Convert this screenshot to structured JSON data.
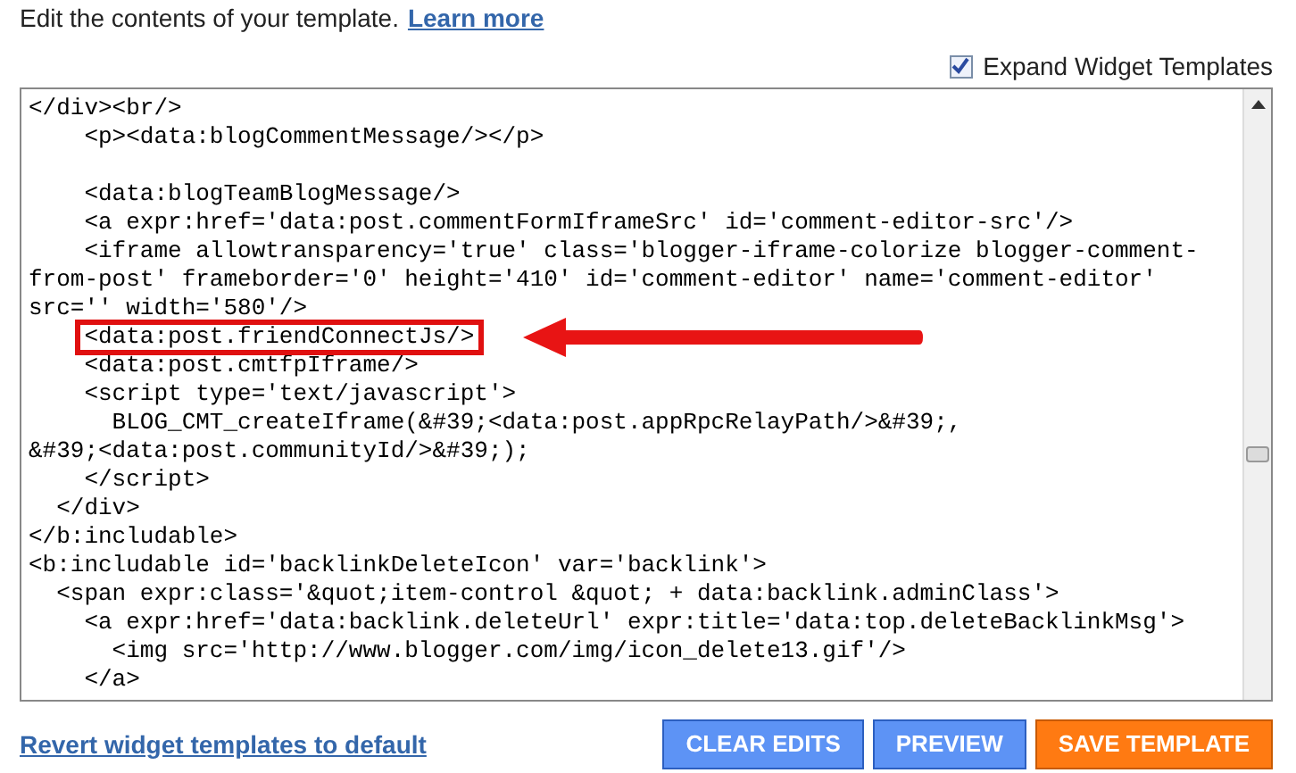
{
  "intro": {
    "text": "Edit the contents of your template.",
    "link": "Learn more"
  },
  "expand_widget_templates": {
    "label": "Expand Widget Templates",
    "checked": true
  },
  "editor": {
    "lines": [
      {
        "kind": "code",
        "text": "</div><br/>"
      },
      {
        "kind": "code",
        "text": "    <p><data:blogCommentMessage/></p>"
      },
      {
        "kind": "blank"
      },
      {
        "kind": "code",
        "text": "    <data:blogTeamBlogMessage/>"
      },
      {
        "kind": "code",
        "text": "    <a expr:href='data:post.commentFormIframeSrc' id='comment-editor-src'/>"
      },
      {
        "kind": "code",
        "text": "    <iframe allowtransparency='true' class='blogger-iframe-colorize blogger-comment-"
      },
      {
        "kind": "code",
        "text": "from-post' frameborder='0' height='410' id='comment-editor' name='comment-editor'"
      },
      {
        "kind": "code",
        "text": "src='' width='580'/>"
      },
      {
        "kind": "code",
        "text": "    <data:post.friendConnectJs/>",
        "highlighted": true
      },
      {
        "kind": "code",
        "text": "    <data:post.cmtfpIframe/>"
      },
      {
        "kind": "code",
        "text": "    <script type='text/javascript'>"
      },
      {
        "kind": "code",
        "text": "      BLOG_CMT_createIframe(&#39;<data:post.appRpcRelayPath/>&#39;,"
      },
      {
        "kind": "code",
        "text": "&#39;<data:post.communityId/>&#39;);"
      },
      {
        "kind": "code",
        "text": "    </script>"
      },
      {
        "kind": "code",
        "text": "  </div>"
      },
      {
        "kind": "code",
        "text": "</b:includable>"
      },
      {
        "kind": "code",
        "text": "<b:includable id='backlinkDeleteIcon' var='backlink'>"
      },
      {
        "kind": "code",
        "text": "  <span expr:class='&quot;item-control &quot; + data:backlink.adminClass'>"
      },
      {
        "kind": "code",
        "text": "    <a expr:href='data:backlink.deleteUrl' expr:title='data:top.deleteBacklinkMsg'>"
      },
      {
        "kind": "code",
        "text": "      <img src='http://www.blogger.com/img/icon_delete13.gif'/>"
      },
      {
        "kind": "code",
        "text": "    </a>"
      }
    ]
  },
  "revert_link": "Revert widget templates to default",
  "buttons": [
    {
      "label": "CLEAR EDITS",
      "kind": "secondary"
    },
    {
      "label": "PREVIEW",
      "kind": "secondary"
    },
    {
      "label": "SAVE TEMPLATE",
      "kind": "primary"
    }
  ]
}
